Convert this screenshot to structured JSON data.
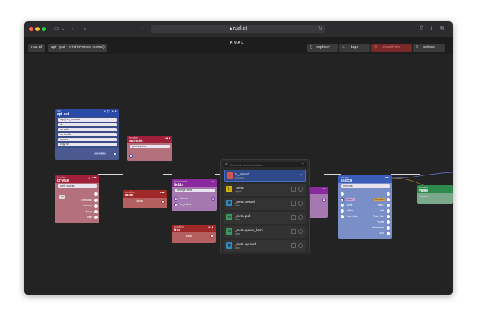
{
  "browser": {
    "url": "rual.at",
    "back_icon": "chevron-left-icon",
    "forward_icon": "chevron-right-icon"
  },
  "app": {
    "breadcrumb": [
      "rual.nl",
      "api - put - print invoices (demo)"
    ],
    "logo": "RUAL",
    "toolbar": {
      "explorer": "explorer",
      "tags": "tags",
      "deactivate": "deactivate",
      "options": "options"
    }
  },
  "nodes": {
    "api_put": {
      "category": "api",
      "title": "api put",
      "fields": [
        "/api/print_invoices",
        "v1",
        "no auth",
        "no throttle",
        "scopes",
        "copy url"
      ],
      "footer_left": "",
      "footer_right": "on finish"
    },
    "execute": {
      "category": "function",
      "title": "execute",
      "field": "print invoices"
    },
    "private": {
      "category": "function",
      "title": "private",
      "field": "print invoices",
      "input_label": "on",
      "outputs": [
        "Executed",
        "Invoices",
        "Query",
        "Total"
      ]
    },
    "false_node": {
      "category": "condition",
      "title": "false",
      "value": "false"
    },
    "true_node": {
      "category": "condition",
      "title": "true",
      "value": "true"
    },
    "fields": {
      "category": "global fields",
      "title": "fields",
      "field": "manage fields",
      "rows": [
        "Source",
        "is_printed"
      ]
    },
    "search": {
      "category": "storage",
      "title": "search",
      "field": "invoices",
      "inputs": [
        "Query",
        "Limit",
        "Offset",
        "Sort Order"
      ],
      "outputs": [
        "Results",
        "Offset",
        "Limit",
        "Total Hits",
        "Facets",
        "Remember",
        "Docs"
      ]
    },
    "value": {
      "category": "variable",
      "title": "value",
      "field": "invoices"
    }
  },
  "dropdown": {
    "placeholder": "Search in /user/rml fields...",
    "items": [
      {
        "name": "is_printed",
        "type": "boolean",
        "color": "#d9534f",
        "icon": "toggle-icon",
        "selected": true
      },
      {
        "name": "_meta",
        "type": "object",
        "color": "#d4b106",
        "icon": "object-icon",
        "selected": false
      },
      {
        "name": "_meta.created",
        "type": "date",
        "color": "#2e8bc0",
        "icon": "calendar-icon",
        "selected": false
      },
      {
        "name": "_meta.guid",
        "type": "value",
        "color": "#3c9b5a",
        "icon": "value-icon",
        "selected": false
      },
      {
        "name": "_meta.update_hash",
        "type": "value",
        "color": "#3c9b5a",
        "icon": "value-icon",
        "selected": false
      },
      {
        "name": "_meta.updated",
        "type": "date",
        "color": "#2e8bc0",
        "icon": "calendar-icon",
        "selected": false
      }
    ]
  },
  "colors": {
    "api_blue": "#2a4aa8",
    "function_red": "#a0203a",
    "condition_red": "#a02828",
    "global_purple": "#8a2a9e",
    "storage_blue": "#3b5cb8",
    "variable_green": "#2e8a4e",
    "deactivate_red": "#8a2a2a"
  }
}
